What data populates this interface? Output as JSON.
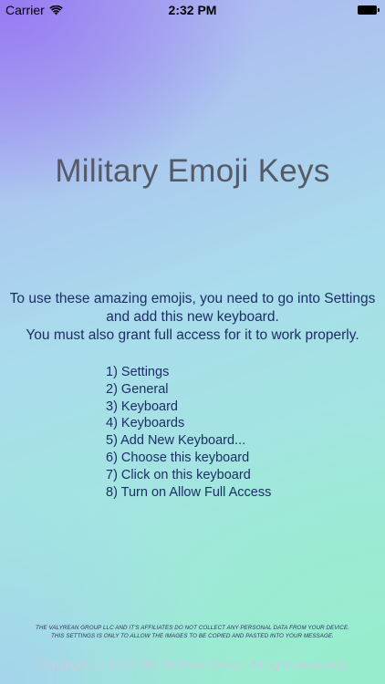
{
  "status_bar": {
    "carrier": "Carrier",
    "time": "2:32 PM",
    "wifi_icon": "wifi-icon",
    "battery_icon": "battery-icon"
  },
  "app": {
    "title": "Military Emoji Keys"
  },
  "intro": {
    "lines": [
      "To use these amazing emojis, you need to go into Settings",
      "and add this new keyboard.",
      "You must also grant full access for it to work properly."
    ]
  },
  "steps": [
    "1) Settings",
    "2) General",
    "3) Keyboard",
    "4) Keyboards",
    "5) Add New Keyboard...",
    "6) Choose this keyboard",
    "7) Click on this keyboard",
    "8) Turn on Allow Full Access"
  ],
  "disclaimer": {
    "lines": [
      "THE VALYREAN GROUP LLC AND IT'S AFFILIATES DO NOT COLLECT ANY PERSONAL DATA FROM YOUR DEVICE.",
      "THIS SETTINGS IS ONLY TO ALLOW THE IMAGES TO BE COPIED AND PASTED INTO YOUR MESSAGE."
    ]
  },
  "footer": {
    "copyright": "Copyright (c) 2016 The Valyrean Group. All rights reserved."
  },
  "colors": {
    "title": "#555a66",
    "body_text": "#1d2e66",
    "copyright": "#c4cfe0",
    "gradient_top_left": "#9676f2",
    "gradient_bottom_right": "#96ecd0"
  }
}
